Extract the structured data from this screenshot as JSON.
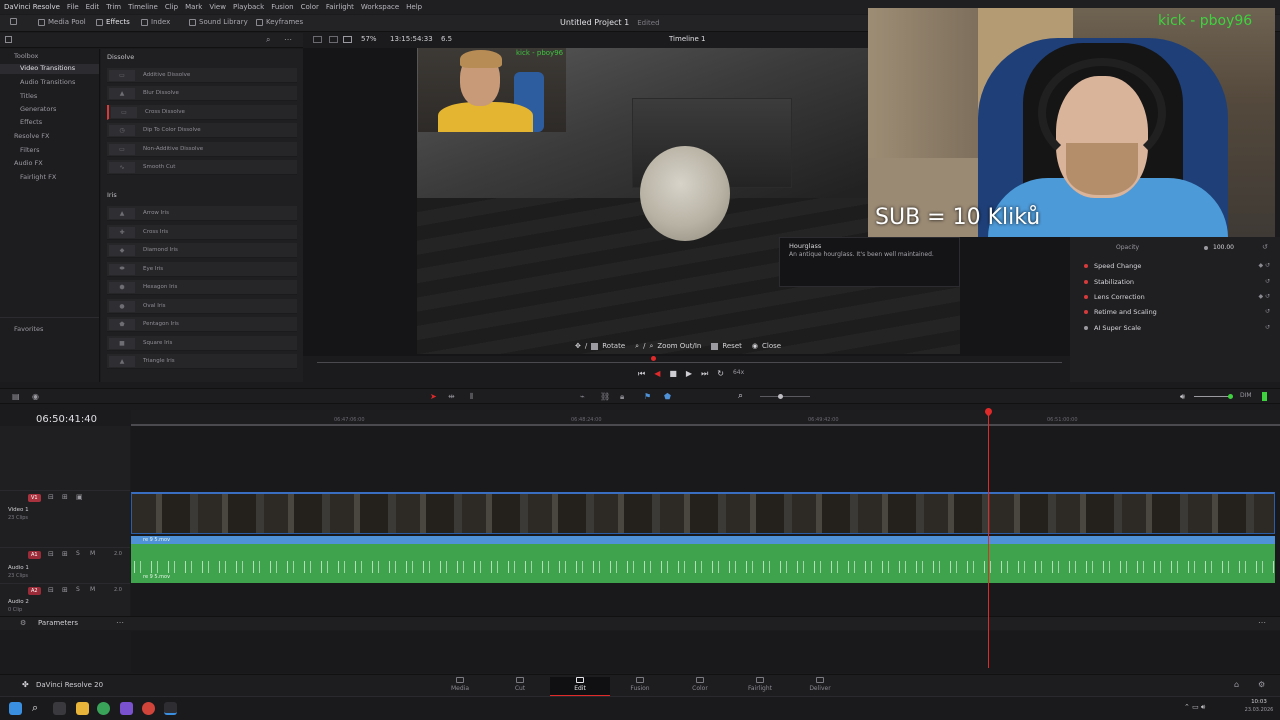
{
  "menubar": {
    "app_name": "DaVinci Resolve",
    "items": [
      "File",
      "Edit",
      "Trim",
      "Timeline",
      "Clip",
      "Mark",
      "View",
      "Playback",
      "Fusion",
      "Color",
      "Fairlight",
      "Workspace",
      "Help"
    ]
  },
  "toolbar": {
    "media_pool": "Media Pool",
    "effects": "Effects",
    "index": "Index",
    "sound_library": "Sound Library",
    "keyframes": "Keyframes",
    "project_title": "Untitled Project 1",
    "edited": "Edited",
    "zoom": "57%",
    "viewer_timecode": "13:15:54:33",
    "fps": "6.5",
    "timeline_name": "Timeline 1"
  },
  "toolbox": {
    "items": [
      {
        "label": "Toolbox"
      },
      {
        "label": "Video Transitions",
        "selected": true
      },
      {
        "label": "Audio Transitions"
      },
      {
        "label": "Titles"
      },
      {
        "label": "Generators"
      },
      {
        "label": "Effects"
      },
      {
        "label": "Resolve FX"
      },
      {
        "label": "Filters"
      },
      {
        "label": "Audio FX"
      },
      {
        "label": "Fairlight FX"
      }
    ],
    "favorites": "Favorites"
  },
  "effects": {
    "dissolve_header": "Dissolve",
    "dissolve": [
      "Additive Dissolve",
      "Blur Dissolve",
      "Cross Dissolve",
      "Dip To Color Dissolve",
      "Non-Additive Dissolve",
      "Smooth Cut"
    ],
    "iris_header": "Iris",
    "iris": [
      "Arrow Iris",
      "Cross Iris",
      "Diamond Iris",
      "Eye Iris",
      "Hexagon Iris",
      "Oval Iris",
      "Pentagon Iris",
      "Square Iris",
      "Triangle Iris"
    ]
  },
  "viewer": {
    "tooltip_title": "Hourglass",
    "tooltip_text": "An antique hourglass. It's been well maintained.",
    "controls": {
      "rotate": "Rotate",
      "zoom": "Zoom Out/In",
      "reset": "Reset",
      "close": "Close"
    },
    "speed": "64x",
    "small_cam_tag": "kick - pboy96"
  },
  "overlay": {
    "sub_text": "SUB = 10 Kliků",
    "kick_tag": "kick - pboy96"
  },
  "inspector": {
    "opacity_label": "Opacity",
    "opacity_value": "100.00",
    "items": [
      "Speed Change",
      "Stabilization",
      "Lens Correction",
      "Retime and Scaling",
      "AI Super Scale"
    ]
  },
  "timeline": {
    "timecode": "06:50:41:40",
    "ruler_ticks": [
      "06:47:06:00",
      "06:48:24:00",
      "06:49:42:00",
      "06:51:00:00"
    ],
    "tracks": [
      {
        "badge": "V1",
        "name": "Video 1",
        "clips": "23 Clips"
      },
      {
        "badge": "A1",
        "name": "Audio 1",
        "clips": "23 Clips",
        "level": "2.0"
      },
      {
        "badge": "A2",
        "name": "Audio 2",
        "clips": "0 Clip",
        "level": "2.0"
      }
    ],
    "clip_name": "re 9 5.mov",
    "parameters": "Parameters",
    "dim": "DIM"
  },
  "pagebar": {
    "brand": "DaVinci Resolve 20",
    "pages": [
      {
        "label": "Media"
      },
      {
        "label": "Cut"
      },
      {
        "label": "Edit",
        "active": true
      },
      {
        "label": "Fusion"
      },
      {
        "label": "Color"
      },
      {
        "label": "Fairlight"
      },
      {
        "label": "Deliver"
      }
    ]
  },
  "taskbar": {
    "time": "10:03",
    "date": "23.03.2026"
  },
  "colors": {
    "accent_red": "#e02a2a",
    "video_track": "#2a5fa8",
    "audio_track": "#3fa34d",
    "kick_green": "#3fd23f"
  }
}
